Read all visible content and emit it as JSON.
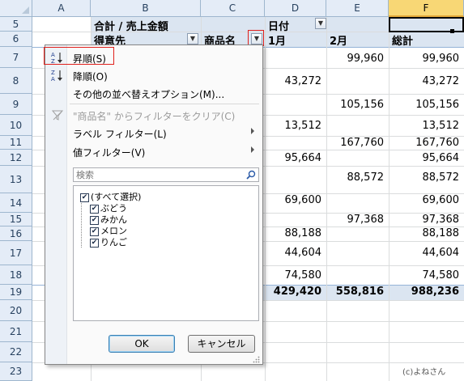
{
  "columns": [
    "A",
    "B",
    "C",
    "D",
    "E",
    "F"
  ],
  "rows": [
    "5",
    "6",
    "7",
    "8",
    "9",
    "10",
    "11",
    "12",
    "13",
    "14",
    "15",
    "16",
    "17",
    "18",
    "19",
    "20",
    "21",
    "22",
    "23"
  ],
  "selected_column": "F",
  "pivot": {
    "header_value_label": "合計 / 売上金額",
    "column_field_label": "日付",
    "row_field_customer": "得意先",
    "row_field_product": "商品名",
    "col_jan": "1月",
    "col_feb": "2月",
    "col_total": "総計",
    "data_rows": [
      {
        "row": "7",
        "d": "",
        "e": "99,960",
        "f": "99,960"
      },
      {
        "row": "8",
        "d": "43,272",
        "e": "",
        "f": "43,272"
      },
      {
        "row": "9",
        "d": "",
        "e": "105,156",
        "f": "105,156"
      },
      {
        "row": "10",
        "d": "13,512",
        "e": "",
        "f": "13,512"
      },
      {
        "row": "11",
        "d": "",
        "e": "167,760",
        "f": "167,760"
      },
      {
        "row": "12",
        "d": "95,664",
        "e": "",
        "f": "95,664"
      },
      {
        "row": "13",
        "d": "",
        "e": "88,572",
        "f": "88,572"
      },
      {
        "row": "14",
        "d": "69,600",
        "e": "",
        "f": "69,600"
      },
      {
        "row": "15",
        "d": "",
        "e": "97,368",
        "f": "97,368"
      },
      {
        "row": "16",
        "d": "88,188",
        "e": "",
        "f": "88,188"
      },
      {
        "row": "17",
        "d": "44,604",
        "e": "",
        "f": "44,604"
      },
      {
        "row": "18",
        "d": "74,580",
        "e": "",
        "f": "74,580"
      }
    ],
    "grand_total": {
      "d": "429,420",
      "e": "558,816",
      "f": "988,236"
    }
  },
  "filter_menu": {
    "sort_ascending": "昇順(S)",
    "sort_descending": "降順(O)",
    "more_sort_options": "その他の並べ替えオプション(M)...",
    "clear_filter": "\"商品名\" からフィルターをクリア(C)",
    "label_filter": "ラベル フィルター(L)",
    "value_filter": "値フィルター(V)",
    "search_placeholder": "検索",
    "items": [
      {
        "label": "(すべて選択)",
        "checked": true
      },
      {
        "label": "ぶどう",
        "checked": true
      },
      {
        "label": "みかん",
        "checked": true
      },
      {
        "label": "メロン",
        "checked": true
      },
      {
        "label": "りんご",
        "checked": true
      }
    ],
    "ok_label": "OK",
    "cancel_label": "キャンセル"
  },
  "credit": "(c)よねさん",
  "colors": {
    "header_bg": "#e4ecf7",
    "pivot_band": "#dbe5f1",
    "highlight_red": "#e0201c",
    "selected_header": "#f8d775"
  }
}
